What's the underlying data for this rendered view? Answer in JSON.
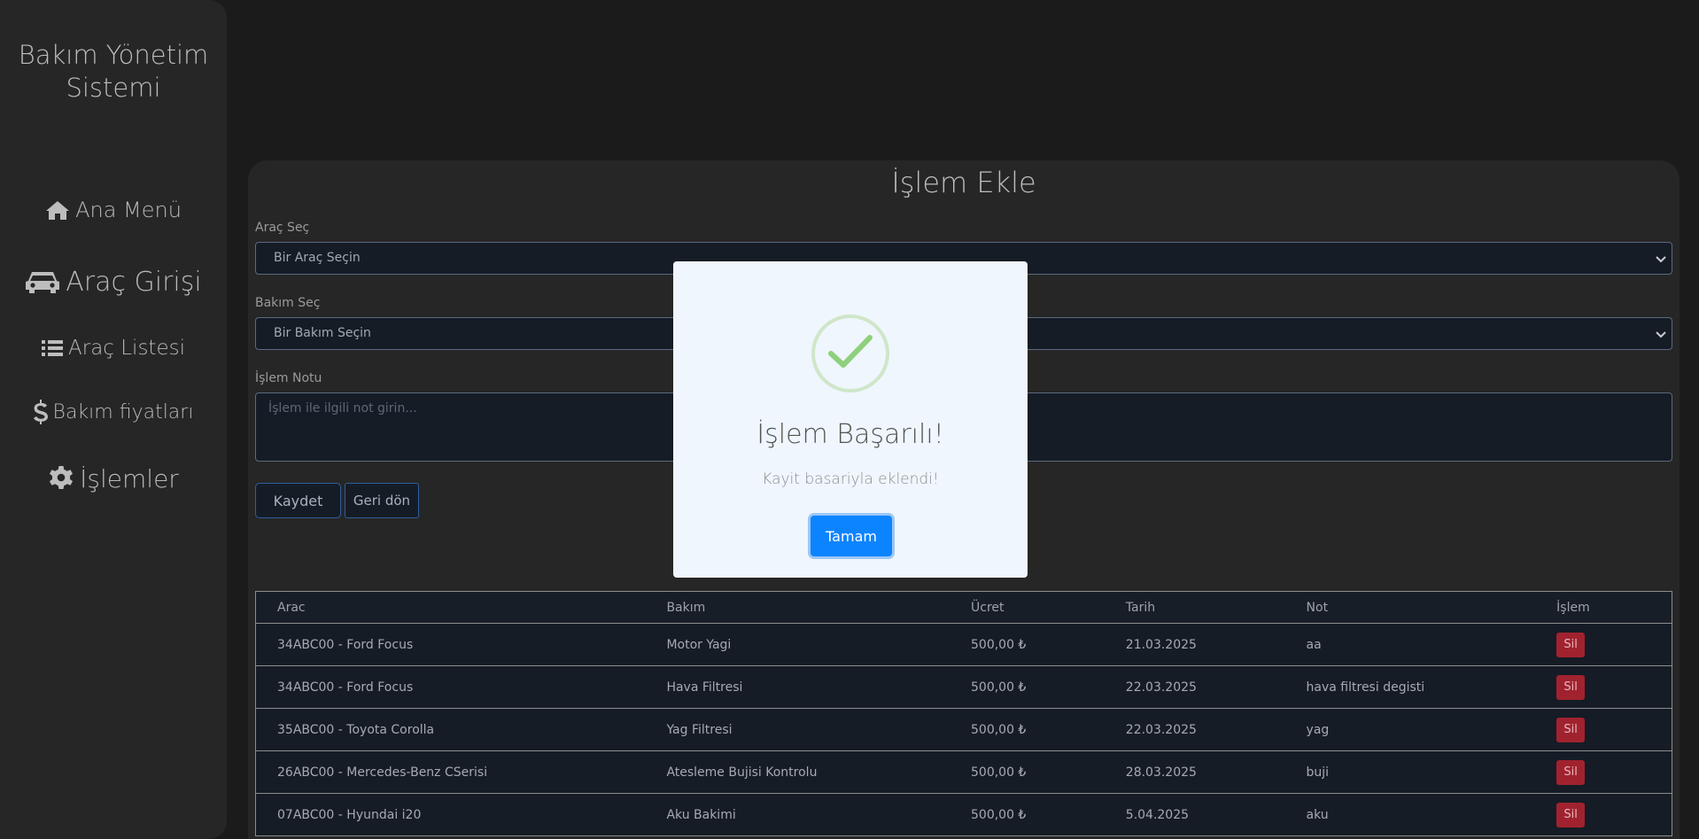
{
  "sidebar": {
    "brand_line1": "Bakım Yönetim",
    "brand_line2": "Sistemi",
    "items": [
      {
        "label": "Ana Menü",
        "icon": "home-icon"
      },
      {
        "label": "Araç Girişi",
        "icon": "car-icon"
      },
      {
        "label": "Araç Listesi",
        "icon": "list-icon"
      },
      {
        "label": "Bakım fiyatları",
        "icon": "dollar-icon"
      },
      {
        "label": "İşlemler",
        "icon": "gear-icon"
      }
    ]
  },
  "form": {
    "title": "İşlem Ekle",
    "vehicle_label": "Araç Seç",
    "vehicle_value": "Bir Araç Seçin",
    "maintenance_label": "Bakım Seç",
    "maintenance_value": "Bir Bakım Seçin",
    "note_label": "İşlem Notu",
    "note_placeholder": "İşlem ile ilgili not girin...",
    "save_label": "Kaydet",
    "back_label": "Geri dön"
  },
  "table": {
    "headers": [
      "Arac",
      "Bakım",
      "Ücret",
      "Tarih",
      "Not",
      "İşlem"
    ],
    "rows": [
      [
        "34ABC00 - Ford Focus",
        "Motor Yagi",
        "500,00 ₺",
        "21.03.2025",
        "aa",
        "Sil"
      ],
      [
        "34ABC00 - Ford Focus",
        "Hava Filtresi",
        "500,00 ₺",
        "22.03.2025",
        "hava filtresi degisti",
        "Sil"
      ],
      [
        "35ABC00 - Toyota Corolla",
        "Yag Filtresi",
        "500,00 ₺",
        "22.03.2025",
        "yag",
        "Sil"
      ],
      [
        "26ABC00 - Mercedes-Benz CSerisi",
        "Atesleme Bujisi Kontrolu",
        "500,00 ₺",
        "28.03.2025",
        "buji",
        "Sil"
      ],
      [
        "07ABC00 - Hyundai i20",
        "Aku Bakimi",
        "500,00 ₺",
        "5.04.2025",
        "aku",
        "Sil"
      ]
    ]
  },
  "modal": {
    "icon": "check-icon",
    "title": "İşlem Başarılı!",
    "text": "Kayit basariyla eklendi!",
    "ok_label": "Tamam"
  },
  "colors": {
    "accent": "#0d84ff",
    "danger": "#a1222f",
    "success": "#8fd07c"
  }
}
